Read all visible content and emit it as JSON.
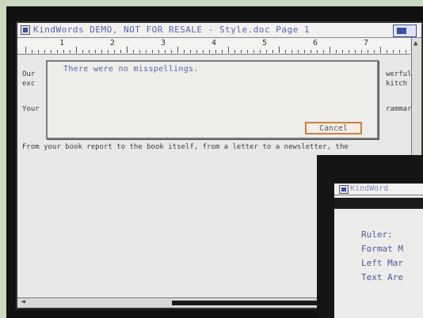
{
  "main_window": {
    "title": "KindWords DEMO, NOT FOR RESALE - Style.doc    Page 1",
    "ruler_numbers": [
      "1",
      "2",
      "3",
      "4",
      "5",
      "6",
      "7"
    ],
    "doc_lines": [
      "Our",
      "exc",
      "Your",
      "From your book report to the book itself, from a letter to a newsletter, the"
    ],
    "right_fragments": [
      "werful",
      "kitch",
      "rammar"
    ]
  },
  "dialog": {
    "message": "There were no misspellings.",
    "cancel_label": "Cancel"
  },
  "second_window": {
    "title": "KindWord",
    "items": [
      "Ruler:",
      "Format M",
      "Left Mar",
      "Text Are"
    ]
  }
}
